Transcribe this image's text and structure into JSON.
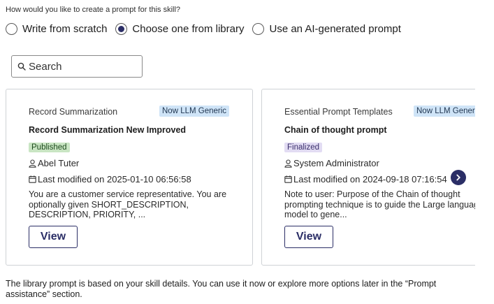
{
  "question": "How would you like to create a prompt for this skill?",
  "radio_options": [
    {
      "label": "Write from scratch",
      "selected": false
    },
    {
      "label": "Choose one from library",
      "selected": true
    },
    {
      "label": "Use an AI-generated prompt",
      "selected": false
    }
  ],
  "search": {
    "placeholder": "Search",
    "value": ""
  },
  "cards": [
    {
      "category": "Record Summarization",
      "badge": "Now LLM Generic",
      "title": "Record Summarization New Improved",
      "status": "Published",
      "author": "Abel Tuter",
      "modified": "Last modified on 2025-01-10 06:56:58",
      "description": "You are a customer service representative. You are optionally given SHORT_DESCRIPTION, DESCRIPTION, PRIORITY, ...",
      "view_label": "View"
    },
    {
      "category": "Essential Prompt Templates",
      "badge": "Now LLM Generic",
      "title": "Chain of thought prompt",
      "status": "Finalized",
      "author": "System Administrator",
      "modified": "Last modified on 2024-09-18 07:16:54",
      "description": "Note to user: Purpose of the Chain of thought prompting technique is to guide the Large language model to gene...",
      "view_label": "View"
    }
  ],
  "footer": "The library prompt is based on your skill details. You can use it now or explore more options later in the “Prompt assistance” section.",
  "colors": {
    "accent": "#2b2e66",
    "badge_bg": "#cfe4f7",
    "published_bg": "#c9e5c3",
    "finalized_bg": "#e2dcf3",
    "card_border": "#cfd2d6"
  },
  "icons": {
    "search": "search-icon",
    "user": "user-icon",
    "calendar": "calendar-icon",
    "next": "chevron-right-icon"
  }
}
